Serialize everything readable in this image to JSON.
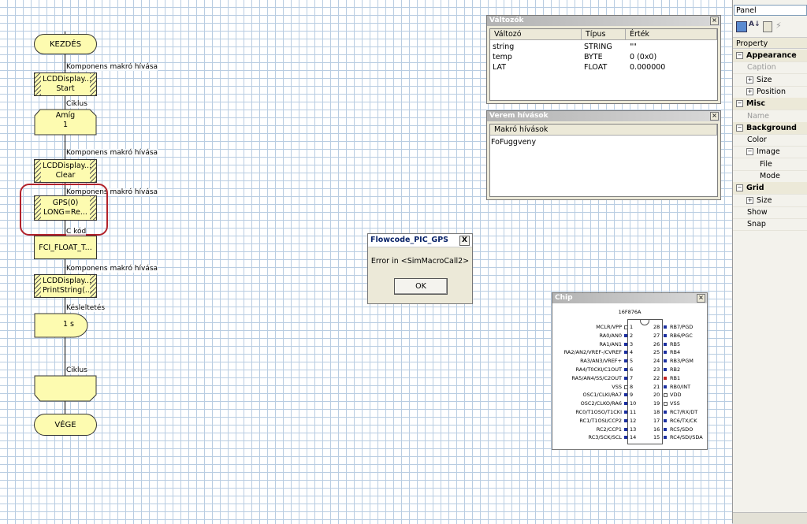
{
  "flowchart": {
    "start_label": "KEZDÉS",
    "end_label": "VÉGE",
    "comp_macro_label": "Komponens makró hívása",
    "loop_label": "Ciklus",
    "code_label": "C kód",
    "delay_label": "Késleltetés",
    "lcd_start": [
      "LCDDisplay...",
      "Start"
    ],
    "loop_block": [
      "Amíg",
      "1"
    ],
    "lcd_clear": [
      "LCDDisplay...",
      "Clear"
    ],
    "gps_block": [
      "GPS(0)",
      "LONG=Re..."
    ],
    "c_block": "FCI_FLOAT_T...",
    "lcd_print": [
      "LCDDisplay...",
      "PrintString(..."
    ],
    "delay_value": "1 s"
  },
  "variables_window": {
    "title": "Változók",
    "columns": [
      "Változó",
      "Típus",
      "Érték"
    ],
    "rows": [
      [
        "string",
        "STRING",
        "\"\""
      ],
      [
        "temp",
        "BYTE",
        "0 (0x0)"
      ],
      [
        "LAT",
        "FLOAT",
        "0.000000"
      ]
    ]
  },
  "stack_window": {
    "title": "Verem hívások",
    "column": "Makró hívások",
    "rows": [
      "FoFuggveny"
    ]
  },
  "dialog": {
    "title": "Flowcode_PIC_GPS",
    "message": "Error in <SimMacroCall2>",
    "ok_label": "OK",
    "close_label": "X"
  },
  "chip_window": {
    "title": "Chip",
    "chip_name": "16F876A",
    "left_pins": [
      "MCLR/VPP",
      "RA0/AN0",
      "RA1/AN1",
      "RA2/AN2/VREF-/CVREF",
      "RA3/AN3/VREF+",
      "RA4/T0CKI/C1OUT",
      "RA5/AN4/SS/C2OUT",
      "VSS",
      "OSC1/CLKI/RA7",
      "OSC2/CLKO/RA6",
      "RC0/T1OSO/T1CKI",
      "RC1/T1OSI/CCP2",
      "RC2/CCP1",
      "RC3/SCK/SCL"
    ],
    "right_pins": [
      "RB7/PGD",
      "RB6/PGC",
      "RB5",
      "RB4",
      "RB3/PGM",
      "RB2",
      "RB1",
      "RB0/INT",
      "VDD",
      "VSS",
      "RC7/RX/DT",
      "RC6/TX/CK",
      "RC5/SDO",
      "RC4/SDI/SDA"
    ],
    "left_numbers": [
      "1",
      "2",
      "3",
      "4",
      "5",
      "6",
      "7",
      "8",
      "9",
      "10",
      "11",
      "12",
      "13",
      "14"
    ],
    "right_numbers": [
      "28",
      "27",
      "26",
      "25",
      "24",
      "23",
      "22",
      "21",
      "20",
      "19",
      "18",
      "17",
      "16",
      "15"
    ]
  },
  "panel": {
    "dropdown_value": "Panel",
    "header": "Property",
    "rows": [
      {
        "label": "Appearance",
        "type": "cat"
      },
      {
        "label": "Caption",
        "type": "gray"
      },
      {
        "label": "Size",
        "type": "expand"
      },
      {
        "label": "Position",
        "type": "expand"
      },
      {
        "label": "Misc",
        "type": "cat"
      },
      {
        "label": "Name",
        "type": "gray"
      },
      {
        "label": "Background",
        "type": "cat"
      },
      {
        "label": "Color",
        "type": "item"
      },
      {
        "label": "Image",
        "type": "subcat"
      },
      {
        "label": "File",
        "type": "sub"
      },
      {
        "label": "Mode",
        "type": "sub"
      },
      {
        "label": "Grid",
        "type": "cat"
      },
      {
        "label": "Size",
        "type": "expand"
      },
      {
        "label": "Show",
        "type": "item"
      },
      {
        "label": "Snap",
        "type": "item"
      }
    ]
  }
}
